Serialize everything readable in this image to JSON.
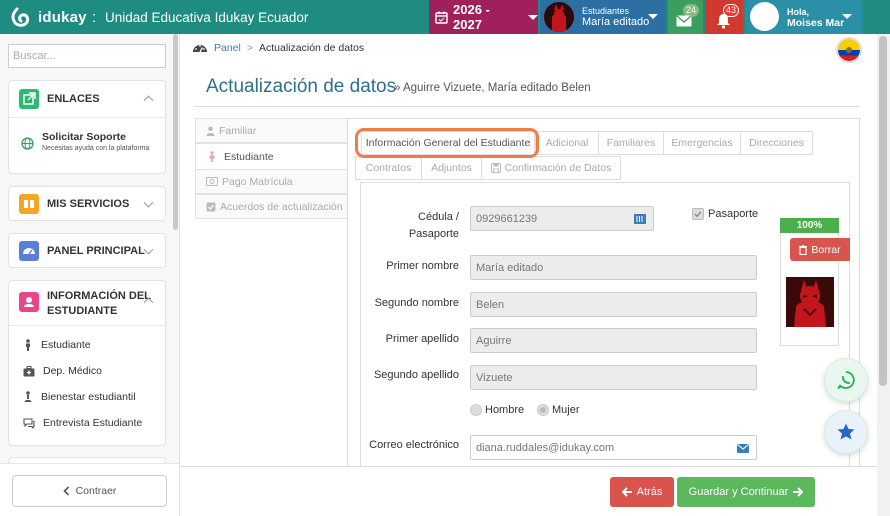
{
  "header": {
    "brand": "idukay",
    "separator": ":",
    "school": "Unidad Educativa Idukay Ecuador",
    "year": "2026 - 2027",
    "student_label": "Estudiantes",
    "student_name": "María editado",
    "messages_count": "24",
    "notifications_count": "43",
    "greeting": "Hola,",
    "user_name": "Moises Mar",
    "colors": {
      "topbar": "#1e8c80",
      "year": "#a0205c",
      "students": "#2e6fa3",
      "messages": "#3a9e61",
      "notifications": "#d03a2e",
      "user": "#2c8fa8"
    }
  },
  "sidebar": {
    "search_placeholder": "Buscar...",
    "enlaces": {
      "title": "ENLACES",
      "link_title": "Solicitar Soporte",
      "link_sub": "Necesitas ayuda con la plataforma"
    },
    "mis_servicios": "MIS SERVICIOS",
    "panel_principal": "PANEL PRINCIPAL",
    "info_estudiante": {
      "title_line1": "INFORMACIÓN DEL",
      "title_line2": "ESTUDIANTE",
      "items": [
        "Estudiante",
        "Dep. Médico",
        "Bienestar estudiantil",
        "Entrevista Estudiante"
      ]
    },
    "collapse_label": "Contraer"
  },
  "breadcrumb": {
    "home": "Panel",
    "separator": ">",
    "current": "Actualización de datos"
  },
  "page": {
    "title": "Actualización de datos",
    "subtitle": "» Aguirre Vizuete, María editado Belen"
  },
  "side_tabs": [
    "Familiar",
    "Estudiante",
    "Pago Matrícula",
    "Acuerdos de actualización"
  ],
  "tabs_row1": [
    "Información General del Estudiante",
    "Adicional",
    "Familiares",
    "Emergencias",
    "Direcciones"
  ],
  "tabs_row2": [
    "Contratos",
    "Adjuntos",
    "Confirmación de Datos"
  ],
  "form": {
    "cedula_label_1": "Cédula /",
    "cedula_label_2": "Pasaporte",
    "cedula_value": "0929661239",
    "pasaporte_label": "Pasaporte",
    "primer_nombre_label": "Primer nombre",
    "primer_nombre_value": "María editado",
    "segundo_nombre_label": "Segundo nombre",
    "segundo_nombre_value": "Belen",
    "primer_apellido_label": "Primer apellido",
    "primer_apellido_value": "Aguirre",
    "segundo_apellido_label": "Segundo apellido",
    "segundo_apellido_value": "Vizuete",
    "gender_options": [
      "Hombre",
      "Mujer"
    ],
    "email_label": "Correo electrónico",
    "email_value": "diana.ruddales@idukay.com"
  },
  "photo": {
    "progress_label": "100%",
    "progress": 1.0,
    "delete_label": "Borrar"
  },
  "footer": {
    "back_label": "Atrás",
    "save_label": "Guardar y Continuar"
  }
}
